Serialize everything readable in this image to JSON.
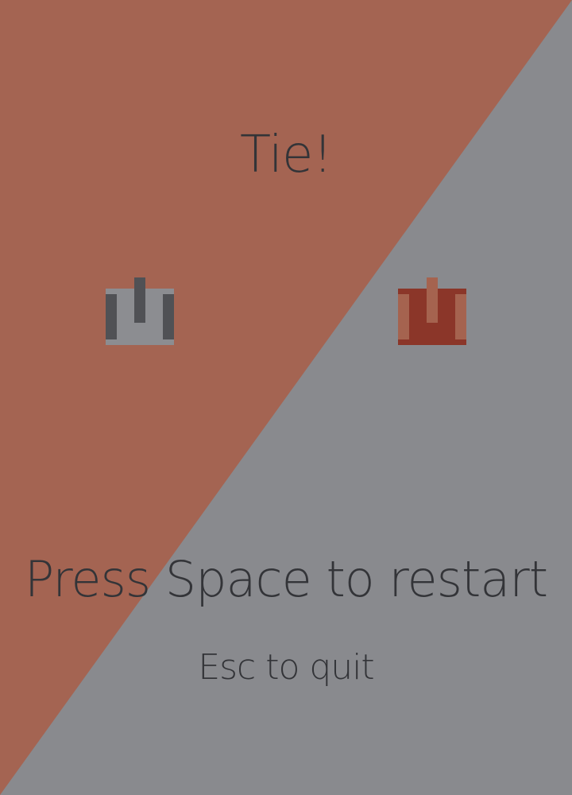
{
  "game": {
    "result": "Tie!",
    "restart_hint": "Press Space to restart",
    "quit_hint": "Esc to quit"
  },
  "players": [
    {
      "name": "left-tank",
      "side": "left",
      "icon": "tank-icon",
      "colors": {
        "body": "#8c8d91",
        "tracks": "#505155",
        "barrel": "#505155"
      }
    },
    {
      "name": "right-tank",
      "side": "right",
      "icon": "tank-icon",
      "colors": {
        "body": "#8b3629",
        "tracks": "#a5634f",
        "barrel": "#a5634f"
      }
    }
  ],
  "colors": {
    "territory_left": "#a46452",
    "territory_right": "#898a8e",
    "text": "#333438"
  }
}
